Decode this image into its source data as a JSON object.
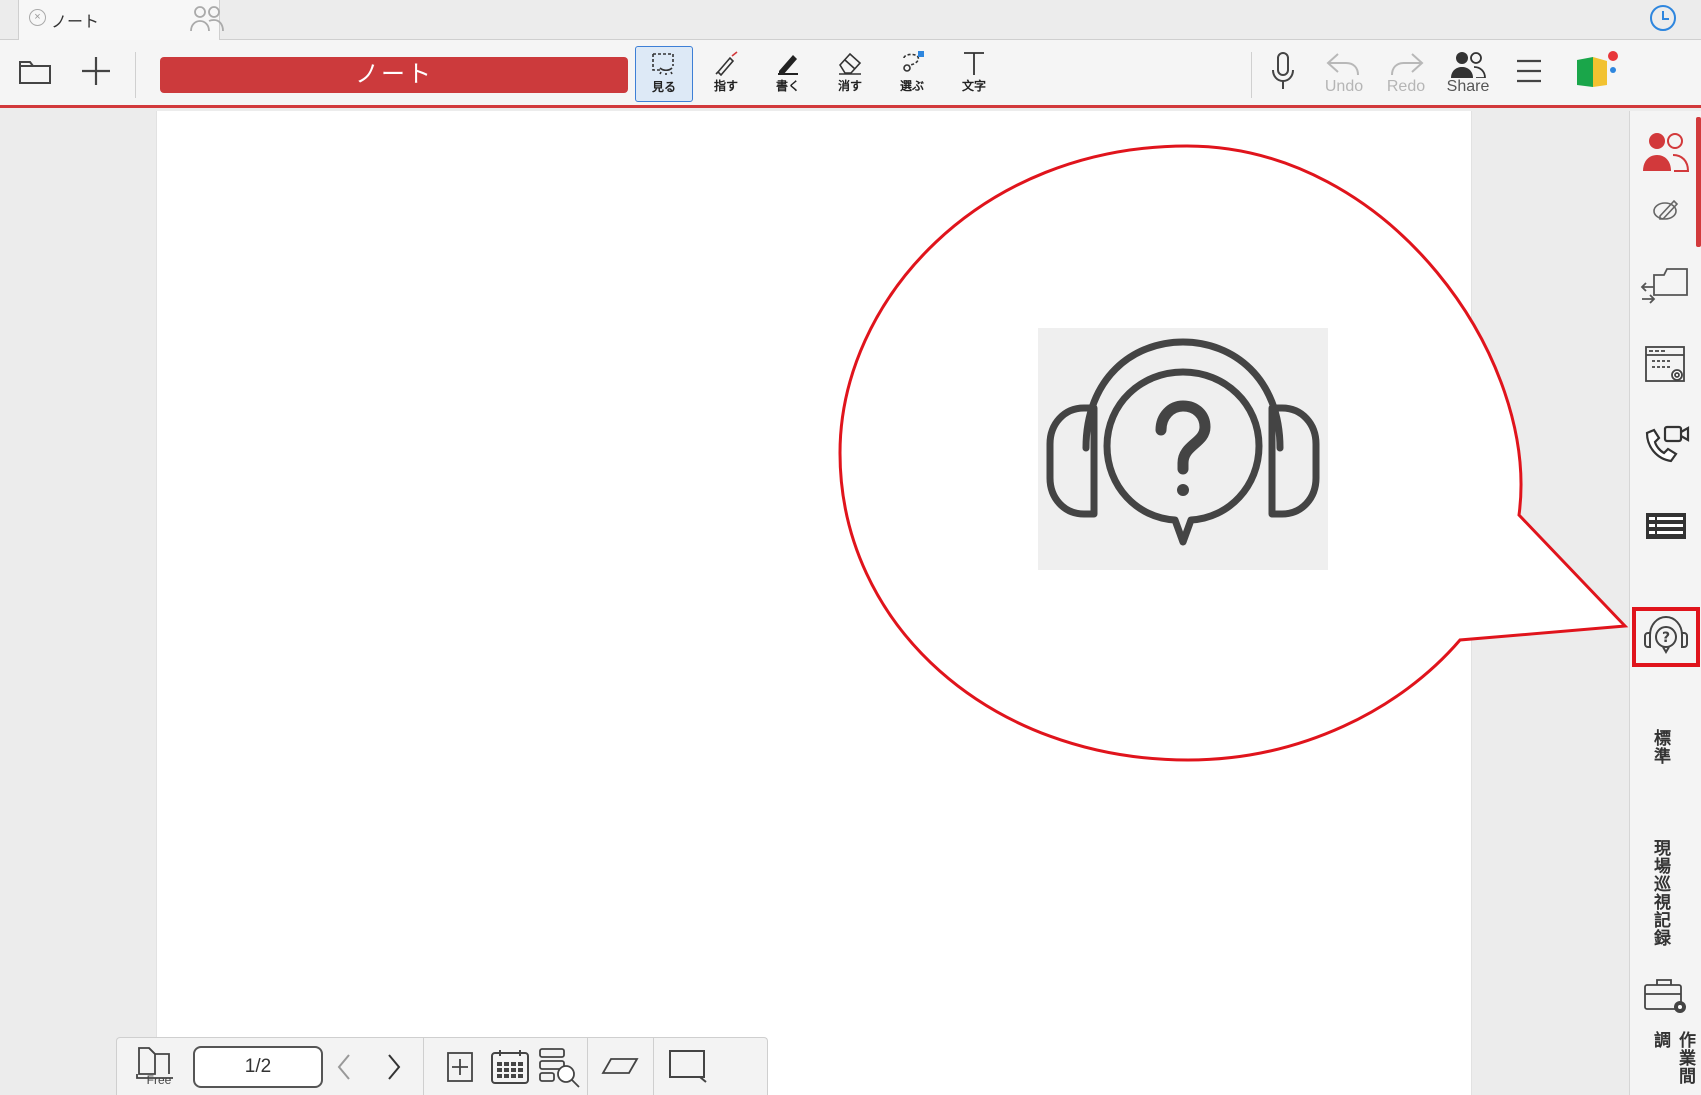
{
  "tab": {
    "title": "ノート"
  },
  "toolbar": {
    "note_title": "ノート",
    "tools": [
      {
        "id": "view",
        "label": "見る",
        "active": true
      },
      {
        "id": "point",
        "label": "指す"
      },
      {
        "id": "write",
        "label": "書く"
      },
      {
        "id": "erase",
        "label": "消す"
      },
      {
        "id": "select",
        "label": "選ぶ"
      },
      {
        "id": "text",
        "label": "文字"
      }
    ],
    "undo_label": "Undo",
    "redo_label": "Redo",
    "share_label": "Share"
  },
  "sidebar": {
    "vertical_labels": [
      "標準",
      "現場巡視記録",
      "作業間調"
    ]
  },
  "bottombar": {
    "free_label": "Free",
    "page_indicator": "1/2"
  },
  "colors": {
    "accent": "#cc3a3c",
    "highlight": "#e0141c",
    "active_tool": "#3d7fd6"
  }
}
